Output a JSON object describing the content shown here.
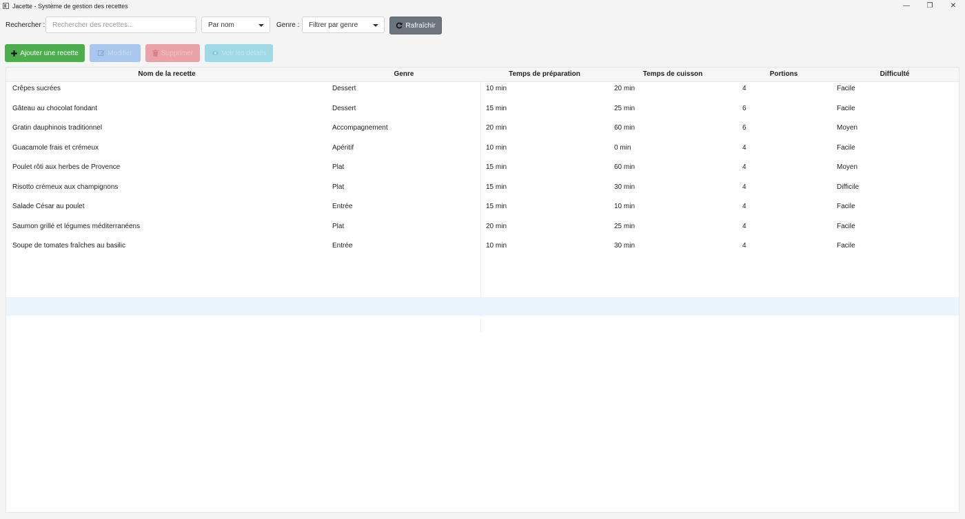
{
  "window": {
    "title": "Jacette - Système de gestion des recettes",
    "minimize_glyph": "—",
    "restore_glyph": "❐",
    "close_glyph": "✕"
  },
  "search": {
    "label": "Rechercher :",
    "placeholder": "Rechercher des recettes...",
    "value": ""
  },
  "sort": {
    "selected": "Par nom"
  },
  "genre": {
    "label": "Genre :",
    "selected": "Filtrer par genre"
  },
  "refresh_label": "Rafraîchir",
  "actions": {
    "add_label": "Ajouter une recette",
    "edit_label": "Modifier",
    "delete_label": "Supprimer",
    "view_label": "Voir les détails"
  },
  "colors": {
    "add": "#4cae4c",
    "edit_disabled": "#a9c6ec",
    "delete_disabled": "#e9a3a8",
    "view_disabled": "#9fd9e6",
    "refresh": "#6c757d",
    "selected_row": "#eaf4fd"
  },
  "icons": {
    "refresh": "refresh-icon",
    "add": "plus-icon",
    "edit": "edit-icon",
    "delete": "trash-icon",
    "view": "eye-icon"
  },
  "table": {
    "columns": [
      "Nom de la recette",
      "Genre",
      "Temps de préparation",
      "Temps de cuisson",
      "Portions",
      "Difficulté"
    ],
    "rows": [
      [
        "Crêpes sucrées",
        "Dessert",
        "10 min",
        "20 min",
        "4",
        "Facile"
      ],
      [
        "Gâteau au chocolat fondant",
        "Dessert",
        "15 min",
        "25 min",
        "6",
        "Facile"
      ],
      [
        "Gratin dauphinois traditionnel",
        "Accompagnement",
        "20 min",
        "60 min",
        "6",
        "Moyen"
      ],
      [
        "Guacamole frais et crémeux",
        "Apéritif",
        "10 min",
        "0 min",
        "4",
        "Facile"
      ],
      [
        "Poulet rôti aux herbes de Provence",
        "Plat",
        "15 min",
        "60 min",
        "4",
        "Moyen"
      ],
      [
        "Risotto crémeux aux champignons",
        "Plat",
        "15 min",
        "30 min",
        "4",
        "Difficile"
      ],
      [
        "Salade César au poulet",
        "Entrée",
        "15 min",
        "10 min",
        "4",
        "Facile"
      ],
      [
        "Saumon grillé et légumes méditerranéens",
        "Plat",
        "20 min",
        "25 min",
        "4",
        "Facile"
      ],
      [
        "Soupe de tomates fraîches au basilic",
        "Entrée",
        "10 min",
        "30 min",
        "4",
        "Facile"
      ]
    ]
  }
}
